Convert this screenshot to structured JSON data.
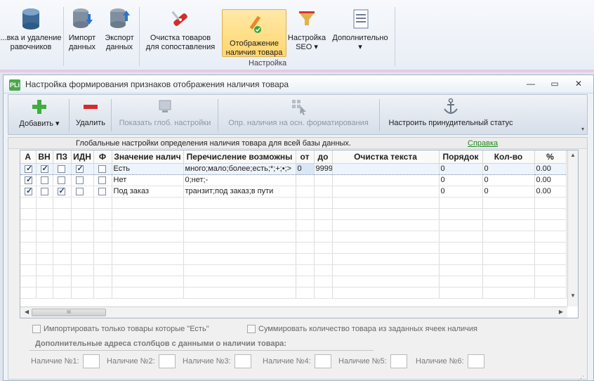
{
  "ribbon": {
    "buttons": [
      {
        "id": "delete-refs",
        "label": "...вка и удаление\nравочников"
      },
      {
        "id": "import",
        "label": "Импорт\nданных"
      },
      {
        "id": "export",
        "label": "Экспорт\nданных"
      },
      {
        "id": "clean",
        "label": "Очистка товаров\nдля сопоставления"
      },
      {
        "id": "availability",
        "label": "Отображение\nналичия товара"
      },
      {
        "id": "seo",
        "label": "Настройка\nSEO ▾"
      },
      {
        "id": "more",
        "label": "Дополнительно\n▾"
      }
    ],
    "group_label": "Настройка"
  },
  "dialog": {
    "title": "Настройка формирования признаков отображения наличия товара",
    "app_icon": "PLi",
    "window_controls": {
      "minimize": "—",
      "restore": "▭",
      "close": "✕"
    }
  },
  "toolbar": {
    "add": "Добавить ▾",
    "remove": "Удалить",
    "show_global": "Показать глоб. настройки",
    "detect": "Опр. наличия на осн. форматирования",
    "force_status": "Настроить принудительный статус"
  },
  "global_bar": {
    "text": "Глобальные настройки определения наличия товара для всей базы данных.",
    "help": "Справка"
  },
  "grid": {
    "columns": [
      "A",
      "ВН",
      "ПЗ",
      "ИДН",
      "Ф",
      "Значение налич",
      "Перечисление возможны",
      "от",
      "до",
      "Очистка текста",
      "Порядок",
      "Кол-во",
      "%"
    ],
    "rows": [
      {
        "a": true,
        "vn": true,
        "pz": false,
        "idn": true,
        "f": false,
        "value": "Есть",
        "list": "много;мало;более;есть;*;+;•;>",
        "from": "0",
        "to": "9999",
        "clean": "",
        "order": "0",
        "qty": "0",
        "pct": "0.00"
      },
      {
        "a": true,
        "vn": false,
        "pz": false,
        "idn": false,
        "f": false,
        "value": "Нет",
        "list": "0;нет;-",
        "from": "",
        "to": "",
        "clean": "",
        "order": "0",
        "qty": "0",
        "pct": "0.00"
      },
      {
        "a": true,
        "vn": false,
        "pz": true,
        "idn": false,
        "f": false,
        "value": "Под заказ",
        "list": "транзит;под заказ;в пути",
        "from": "",
        "to": "",
        "clean": "",
        "order": "0",
        "qty": "0",
        "pct": "0.00"
      }
    ],
    "scroll_thumb_label": "III"
  },
  "options": {
    "import_only": "Импортировать только товары которые \"Есть\"",
    "sum_qty": "Суммировать количество товара из заданных ячеек наличия"
  },
  "addresses": {
    "title": "Дополнительные адреса столбцов с данными о наличии товара:",
    "fields": [
      "Наличие №1:",
      "Наличие №2:",
      "Наличие №3:",
      "Наличие №4:",
      "Наличие №5:",
      "Наличие №6:"
    ]
  }
}
